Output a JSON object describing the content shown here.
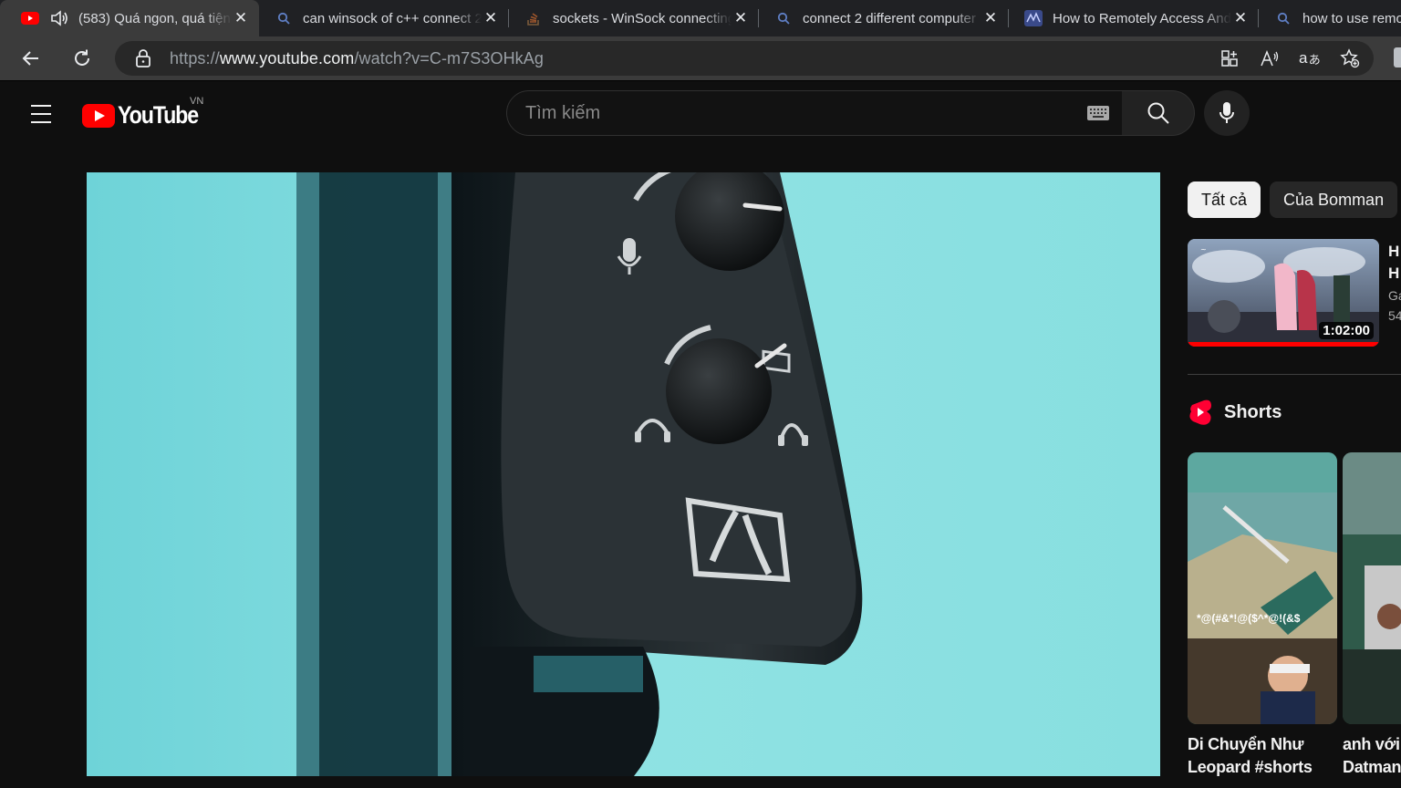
{
  "browser": {
    "tabs": [
      {
        "title": "(583) Quá ngon, quá tiện",
        "favicon": "youtube-icon",
        "active": true,
        "audio": true
      },
      {
        "title": "can winsock of c++ connect 2",
        "favicon": "search-icon",
        "active": false
      },
      {
        "title": "sockets - WinSock connecting",
        "favicon": "stackoverflow-icon",
        "active": false
      },
      {
        "title": "connect 2 different computer",
        "favicon": "search-icon",
        "active": false
      },
      {
        "title": "How to Remotely Access And",
        "favicon": "site-icon",
        "active": false
      },
      {
        "title": "how to use remo",
        "favicon": "search-icon",
        "active": false
      }
    ],
    "address": {
      "scheme": "https://",
      "host": "www.youtube.com",
      "path": "/watch?v=C-m7S3OHkAg"
    }
  },
  "youtube": {
    "logo_text": "YouTube",
    "country_code": "VN",
    "search_placeholder": "Tìm kiếm"
  },
  "sidebar": {
    "chips": [
      {
        "label": "Tất cả",
        "selected": true
      },
      {
        "label": "Của Bomman",
        "selected": false
      }
    ],
    "recommended": {
      "duration": "1:02:00",
      "watched_fraction": 1.0,
      "title_visible": "H",
      "title_visible_line2": "H",
      "channel_visible": "Ga",
      "meta_visible": "54"
    },
    "shorts_heading": "Shorts",
    "shorts": [
      {
        "title": "Di Chuyển Như Leopard #shorts",
        "overlay_text": "*@(#&*!@($^*@!(&$"
      },
      {
        "title": "anh với Datmani"
      }
    ]
  },
  "colors": {
    "youtube_red": "#ff0000",
    "background": "#0f0f0f",
    "chip_selected": "#f1f1f1",
    "video_backdrop": "#7fdcdf"
  }
}
